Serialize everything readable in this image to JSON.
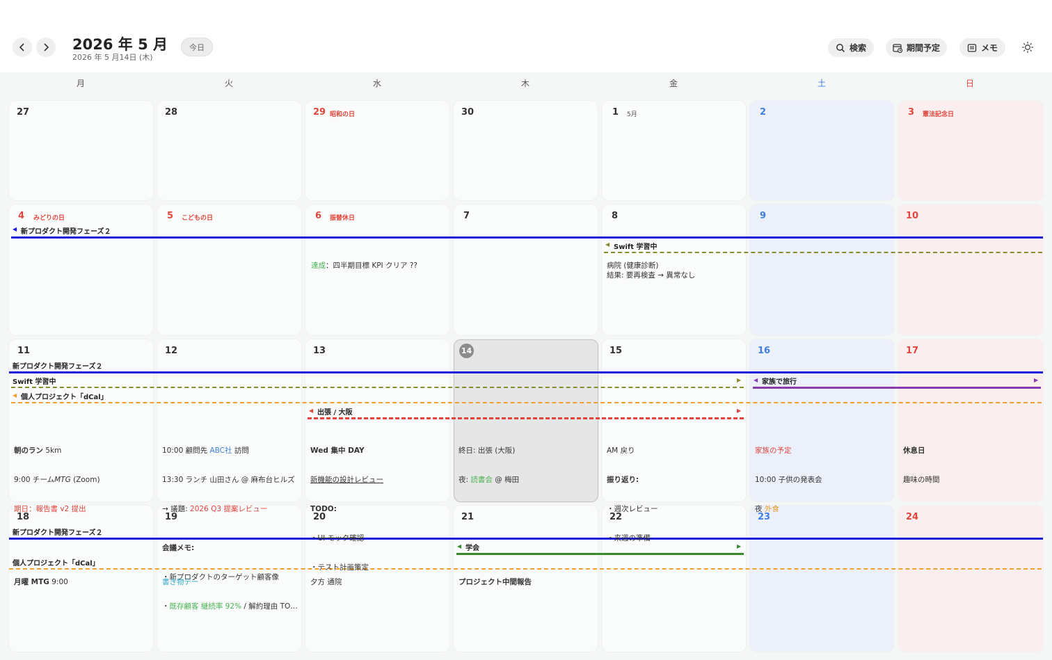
{
  "toolbar": {
    "title": "2026 年 5 月",
    "subtitle": "2026 年 5 月14日 (木)",
    "today_label": "今日",
    "search_label": "検索",
    "period_label": "期間予定",
    "memo_label": "メモ"
  },
  "weekdays": [
    "月",
    "火",
    "水",
    "木",
    "金",
    "土",
    "日"
  ],
  "days": {
    "r1": [
      "27",
      "28",
      "29",
      "30",
      "1",
      "2",
      "3"
    ],
    "r2": [
      "4",
      "5",
      "6",
      "7",
      "8",
      "9",
      "10"
    ],
    "r3": [
      "11",
      "12",
      "13",
      "14",
      "15",
      "16",
      "17"
    ],
    "r4": [
      "18",
      "19",
      "20",
      "21",
      "22",
      "23",
      "24"
    ]
  },
  "holidays": {
    "apr29": "昭和の日",
    "may1_month": "5月",
    "may3": "憲法記念日",
    "may4": "みどりの日",
    "may5": "こどもの日",
    "may6": "振替休日"
  },
  "events": {
    "newproduct": "新プロダクト開発フェーズ２",
    "swift": "Swift 学習中",
    "family_trip": "家族で旅行",
    "personal_project": "個人プロジェクト「dCal」",
    "osaka": "出張 / 大阪",
    "conference": "学会"
  },
  "notes": {
    "may6_done": "達成",
    "may6_text": "：四半期目標 KPI クリア ??",
    "may8_l1": "病院 (健康診断)",
    "may8_l2": "結果: 要再検査 → 異常なし",
    "may11_l1a": "朝のラン",
    "may11_l1b": " 5km",
    "may11_l2a": "9:00 チーム",
    "may11_l2b": "MTG",
    "may11_l2c": " (Zoom)",
    "may11_l3": "期日：報告書 v2 提出",
    "may12_l1a": "10:00 顧問先 ",
    "may12_l1b": "ABC社",
    "may12_l1c": " 訪問",
    "may12_l2": "13:30 ランチ 山田さん @ 麻布台ヒルズ",
    "may12_l3a": "→ 議題: ",
    "may12_l3b": "2026 Q3 提案レビュー",
    "may12_l4": "会議メモ:",
    "may12_l5": "・新プロダクトのターゲット顧客像",
    "may12_l6a": "・",
    "may12_l6b": "既存顧客 継続率 92%",
    "may12_l6c": " / 解約理由 TO…",
    "may13_l1": "Wed 集中 DAY",
    "may13_l2": "新機能の設計レビュー",
    "may13_l3": "TODO:",
    "may13_l4a": "・",
    "may13_l4b": "UI モック確認",
    "may13_l5": "・テスト計画策定",
    "may14_l1": "終日: 出張 (大阪)",
    "may14_l2a": "夜: ",
    "may14_l2b": "読書会",
    "may14_l2c": " @ 梅田",
    "may15_l1": "AM 戻り",
    "may15_l2": "振り返り:",
    "may15_l3": "・週次レビュー",
    "may15_l4": "・来週の準備",
    "may16_l1": "家族の予定",
    "may16_l2": "10:00 子供の発表会",
    "may16_l3a": "夜 ",
    "may16_l3b": "外食",
    "may17_l1": "休息日",
    "may17_l2": "趣味の時間",
    "may18_a": "月曜 MTG",
    "may18_b": " 9:00",
    "may19": "書き物デー",
    "may20": "夕方 通院",
    "may21": "プロジェクト中間報告"
  },
  "colors": {
    "newproduct": "#1a1adb",
    "swift": "#8a8a2e",
    "family_trip": "#8a3bb0",
    "personal_project": "#f0a030",
    "osaka": "#e0463c",
    "conference": "#3a8a2e",
    "holiday": "#e0463c",
    "saturday": "#3d7ee0"
  }
}
